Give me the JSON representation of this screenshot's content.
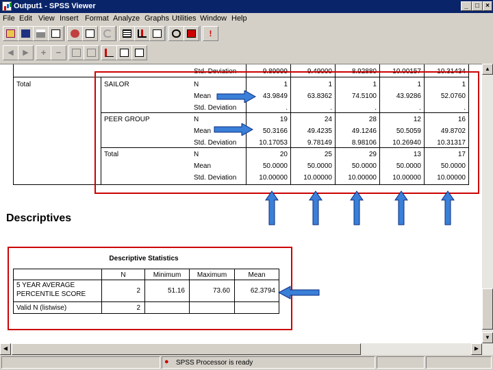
{
  "window": {
    "title": "Output1 - SPSS Viewer",
    "controls": [
      "_",
      "× restore",
      "x"
    ]
  },
  "menu": [
    "File",
    "Edit",
    "View",
    "Insert",
    "Format",
    "Analyze",
    "Graphs",
    "Utilities",
    "Window",
    "Help"
  ],
  "toolbar1": [
    "open-icon",
    "save-icon",
    "print-icon",
    "print-preview-icon",
    "export-icon",
    "dialog-recall-icon",
    "undo-icon",
    "goto-data-icon",
    "goto-chart-icon",
    "variables-icon",
    "use-sets-icon",
    "designate-window-icon",
    "insert-object-icon"
  ],
  "toolbar2": [
    "promote-icon",
    "demote-icon",
    "expand-icon",
    "collapse-icon",
    "show-icon",
    "hide-icon",
    "insert-heading-icon",
    "insert-title-icon",
    "insert-text-icon"
  ],
  "table1": {
    "cut_row": {
      "label": "Std. Deviation",
      "values": [
        "9.89999",
        "9.49000",
        "8.92880",
        "10.00157",
        "10.31434"
      ]
    },
    "group": "Total",
    "blocks": [
      {
        "name": "SAILOR",
        "rows": [
          {
            "stat": "N",
            "values": [
              "1",
              "1",
              "1",
              "1",
              "1"
            ]
          },
          {
            "stat": "Mean",
            "values": [
              "43.9849",
              "63.8362",
              "74.5100",
              "43.9286",
              "52.0760"
            ]
          },
          {
            "stat": "Std. Deviation",
            "values": [
              ".",
              ".",
              ".",
              ".",
              "."
            ]
          }
        ]
      },
      {
        "name": "PEER GROUP",
        "rows": [
          {
            "stat": "N",
            "values": [
              "19",
              "24",
              "28",
              "12",
              "16"
            ]
          },
          {
            "stat": "Mean",
            "values": [
              "50.3166",
              "49.4235",
              "49.1246",
              "50.5059",
              "49.8702"
            ]
          },
          {
            "stat": "Std. Deviation",
            "values": [
              "10.17053",
              "9.78149",
              "8.98106",
              "10.26940",
              "10.31317"
            ]
          }
        ]
      },
      {
        "name": "Total",
        "rows": [
          {
            "stat": "N",
            "values": [
              "20",
              "25",
              "29",
              "13",
              "17"
            ]
          },
          {
            "stat": "Mean",
            "values": [
              "50.0000",
              "50.0000",
              "50.0000",
              "50.0000",
              "50.0000"
            ]
          },
          {
            "stat": "Std. Deviation",
            "values": [
              "10.00000",
              "10.00000",
              "10.00000",
              "10.00000",
              "10.00000"
            ]
          }
        ]
      }
    ]
  },
  "descriptives_heading": "Descriptives",
  "table2": {
    "title": "Descriptive Statistics",
    "headers": [
      "",
      "N",
      "Minimum",
      "Maximum",
      "Mean"
    ],
    "rows": [
      {
        "label": "5 YEAR AVERAGE PERCENTILE SCORE",
        "label_line1": "5 YEAR AVERAGE",
        "label_line2": "PERCENTILE SCORE",
        "n": "2",
        "min": "51.16",
        "max": "73.60",
        "mean": "62.3794"
      },
      {
        "label": "Valid N (listwise)",
        "n": "2",
        "min": "",
        "max": "",
        "mean": ""
      }
    ]
  },
  "status": {
    "processor": "SPSS Processor  is ready"
  },
  "colors": {
    "highlight_box": "#cc0000",
    "arrow": "#3a7fd8",
    "titlebar": "#0a246a"
  }
}
